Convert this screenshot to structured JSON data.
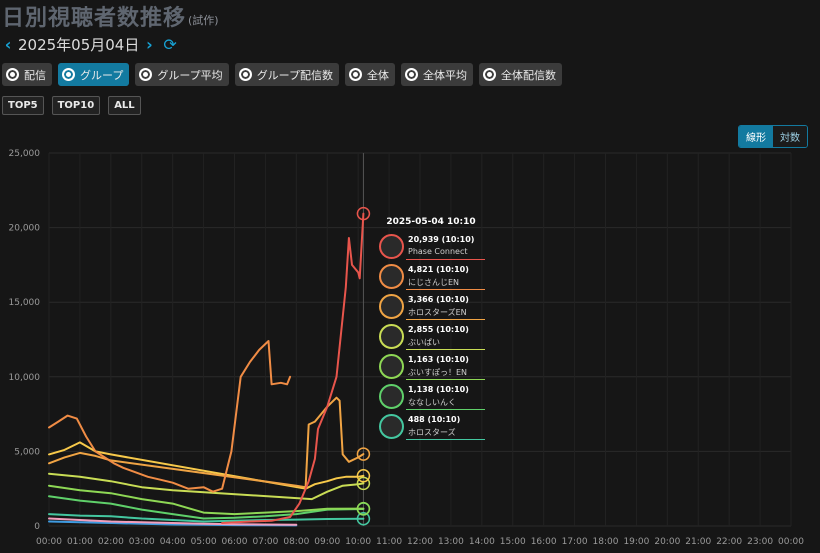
{
  "header": {
    "title": "日別視聴者数推移",
    "title_suffix": "(試作)"
  },
  "date_nav": {
    "prev_icon": "chevron-left-icon",
    "date": "2025年05月04日",
    "next_icon": "chevron-right-icon",
    "refresh_icon": "refresh-icon"
  },
  "view_options": [
    {
      "label": "配信",
      "selected": false
    },
    {
      "label": "グループ",
      "selected": true
    },
    {
      "label": "グループ平均",
      "selected": false
    },
    {
      "label": "グループ配信数",
      "selected": false
    },
    {
      "label": "全体",
      "selected": false
    },
    {
      "label": "全体平均",
      "selected": false
    },
    {
      "label": "全体配信数",
      "selected": false
    }
  ],
  "top_filters": [
    "TOP5",
    "TOP10",
    "ALL"
  ],
  "scale_toggle": {
    "linear": "線形",
    "log": "対数",
    "selected": "線形"
  },
  "accent_color": "#137aa0",
  "chart_data": {
    "type": "line",
    "title": "",
    "xlabel": "",
    "ylabel": "",
    "ylim": [
      0,
      25000
    ],
    "yticks": [
      "0",
      "5,000",
      "10,000",
      "15,000",
      "20,000",
      "25,000"
    ],
    "xticks": [
      "00:00",
      "01:00",
      "02:00",
      "03:00",
      "04:00",
      "05:00",
      "06:00",
      "07:00",
      "08:00",
      "09:00",
      "10:00",
      "11:00",
      "12:00",
      "13:00",
      "14:00",
      "15:00",
      "16:00",
      "17:00",
      "18:00",
      "19:00",
      "20:00",
      "21:00",
      "22:00",
      "23:00",
      "00:00"
    ],
    "grid": true,
    "crosshair_hour": 10.17,
    "series": [
      {
        "name": "Phase Connect",
        "color": "#e8554c",
        "points": [
          [
            5.6,
            200
          ],
          [
            6.5,
            300
          ],
          [
            7.2,
            350
          ],
          [
            7.8,
            600
          ],
          [
            8.1,
            1500
          ],
          [
            8.4,
            3000
          ],
          [
            8.6,
            4500
          ],
          [
            8.7,
            6500
          ],
          [
            9.0,
            8000
          ],
          [
            9.3,
            10000
          ],
          [
            9.6,
            16000
          ],
          [
            9.7,
            19300
          ],
          [
            9.8,
            17500
          ],
          [
            10.0,
            17000
          ],
          [
            10.05,
            16600
          ],
          [
            10.1,
            18500
          ],
          [
            10.17,
            20939
          ]
        ]
      },
      {
        "name": "にじさんじEN",
        "color": "#f08c45",
        "points": [
          [
            0,
            6600
          ],
          [
            0.3,
            7000
          ],
          [
            0.6,
            7400
          ],
          [
            0.9,
            7200
          ],
          [
            1.2,
            6000
          ],
          [
            1.5,
            5000
          ],
          [
            1.8,
            4600
          ],
          [
            2.1,
            4200
          ],
          [
            2.4,
            3900
          ],
          [
            2.8,
            3600
          ],
          [
            3.2,
            3300
          ],
          [
            3.6,
            3100
          ],
          [
            4.0,
            2900
          ],
          [
            4.5,
            2500
          ],
          [
            5.0,
            2600
          ],
          [
            5.3,
            2300
          ],
          [
            5.6,
            2500
          ],
          [
            5.9,
            5000
          ],
          [
            6.2,
            10000
          ],
          [
            6.5,
            11000
          ],
          [
            6.8,
            11800
          ],
          [
            7.1,
            12400
          ],
          [
            7.2,
            9500
          ],
          [
            7.5,
            9600
          ],
          [
            7.7,
            9500
          ],
          [
            7.8,
            10000
          ]
        ]
      },
      {
        "name": "ホロスターズEN",
        "color": "#f0a444",
        "points": [
          [
            0,
            4200
          ],
          [
            0.5,
            4600
          ],
          [
            1.0,
            4900
          ],
          [
            1.5,
            4700
          ],
          [
            2.0,
            4400
          ],
          [
            8.0,
            2700
          ],
          [
            8.3,
            2600
          ],
          [
            8.4,
            6800
          ],
          [
            8.6,
            7000
          ],
          [
            8.8,
            7500
          ],
          [
            9.0,
            8000
          ],
          [
            9.3,
            8600
          ],
          [
            9.4,
            8400
          ],
          [
            9.5,
            4800
          ],
          [
            9.7,
            4300
          ],
          [
            10.0,
            4600
          ],
          [
            10.17,
            4821
          ]
        ]
      },
      {
        "name": "ぶいぱい",
        "color": "#f7c94a",
        "points": [
          [
            0,
            4800
          ],
          [
            0.5,
            5100
          ],
          [
            1.0,
            5600
          ],
          [
            1.5,
            5000
          ],
          [
            2.0,
            4800
          ],
          [
            8.3,
            2500
          ],
          [
            8.6,
            2800
          ],
          [
            9.0,
            3000
          ],
          [
            9.3,
            3200
          ],
          [
            9.6,
            3300
          ],
          [
            10.0,
            3300
          ],
          [
            10.17,
            3366
          ]
        ]
      },
      {
        "name": "ぶいすぽっ！EN",
        "color": "#c9dd55",
        "points": [
          [
            0,
            3500
          ],
          [
            1.0,
            3300
          ],
          [
            2.0,
            3000
          ],
          [
            3.0,
            2600
          ],
          [
            4.0,
            2400
          ],
          [
            8.5,
            1800
          ],
          [
            9.0,
            2300
          ],
          [
            9.5,
            2700
          ],
          [
            10.0,
            2800
          ],
          [
            10.17,
            2855
          ]
        ]
      },
      {
        "name": "ななしいんく",
        "color": "#8ed855",
        "points": [
          [
            0,
            2700
          ],
          [
            1.0,
            2400
          ],
          [
            2.0,
            2200
          ],
          [
            3.0,
            1800
          ],
          [
            4.0,
            1500
          ],
          [
            5.0,
            900
          ],
          [
            6.0,
            800
          ],
          [
            7.0,
            900
          ],
          [
            8.0,
            1000
          ],
          [
            9.0,
            1150
          ],
          [
            10.17,
            1163
          ]
        ]
      },
      {
        "name": "ホロスターズ",
        "color": "#5fd06a",
        "points": [
          [
            0,
            2000
          ],
          [
            1.0,
            1700
          ],
          [
            2.0,
            1500
          ],
          [
            3.0,
            1100
          ],
          [
            4.0,
            800
          ],
          [
            5.0,
            500
          ],
          [
            6.0,
            550
          ],
          [
            7.0,
            650
          ],
          [
            8.0,
            800
          ],
          [
            9.0,
            1100
          ],
          [
            10.17,
            1138
          ]
        ]
      },
      {
        "name": "",
        "color": "#44c7a0",
        "points": [
          [
            0,
            800
          ],
          [
            1.0,
            700
          ],
          [
            2.0,
            650
          ],
          [
            3.0,
            500
          ],
          [
            4.0,
            400
          ],
          [
            5.0,
            300
          ],
          [
            6.0,
            350
          ],
          [
            7.0,
            400
          ],
          [
            8.0,
            430
          ],
          [
            9.0,
            470
          ],
          [
            10.17,
            488
          ]
        ]
      },
      {
        "name": "",
        "color": "#f29fbd",
        "points": [
          [
            0,
            500
          ],
          [
            1.0,
            400
          ],
          [
            2.0,
            300
          ],
          [
            3.0,
            250
          ],
          [
            4.0,
            200
          ],
          [
            5.0,
            150
          ],
          [
            6.0,
            120
          ],
          [
            7.0,
            100
          ],
          [
            8.0,
            90
          ]
        ]
      },
      {
        "name": "",
        "color": "#3f9be0",
        "points": [
          [
            0,
            300
          ],
          [
            1.0,
            250
          ],
          [
            2.0,
            200
          ],
          [
            3.0,
            150
          ],
          [
            4.0,
            100
          ],
          [
            5.0,
            80
          ],
          [
            6.0,
            60
          ],
          [
            7.0,
            50
          ],
          [
            8.0,
            40
          ]
        ]
      }
    ]
  },
  "tooltip": {
    "title": "2025-05-04 10:10",
    "rows": [
      {
        "value": "20,939 (10:10)",
        "name": "Phase Connect",
        "color": "#e8554c",
        "icon": "phase-connect-logo-icon"
      },
      {
        "value": "4,821 (10:10)",
        "name": "にじさんじEN",
        "color": "#f08c45",
        "icon": "nijisanji-en-logo-icon"
      },
      {
        "value": "3,366 (10:10)",
        "name": "ホロスターズEN",
        "color": "#f0a444",
        "icon": "holostars-en-logo-icon"
      },
      {
        "value": "2,855 (10:10)",
        "name": "ぶいぱい",
        "color": "#c9dd55",
        "icon": "vpai-logo-icon"
      },
      {
        "value": "1,163 (10:10)",
        "name": "ぶいすぽっ！EN",
        "color": "#8ed855",
        "icon": "vspo-en-logo-icon"
      },
      {
        "value": "1,138 (10:10)",
        "name": "ななしいんく",
        "color": "#5fd06a",
        "icon": "nanashi-inc-logo-icon"
      },
      {
        "value": "488 (10:10)",
        "name": "ホロスターズ",
        "color": "#44c7a0",
        "icon": "holostars-logo-icon"
      }
    ]
  }
}
